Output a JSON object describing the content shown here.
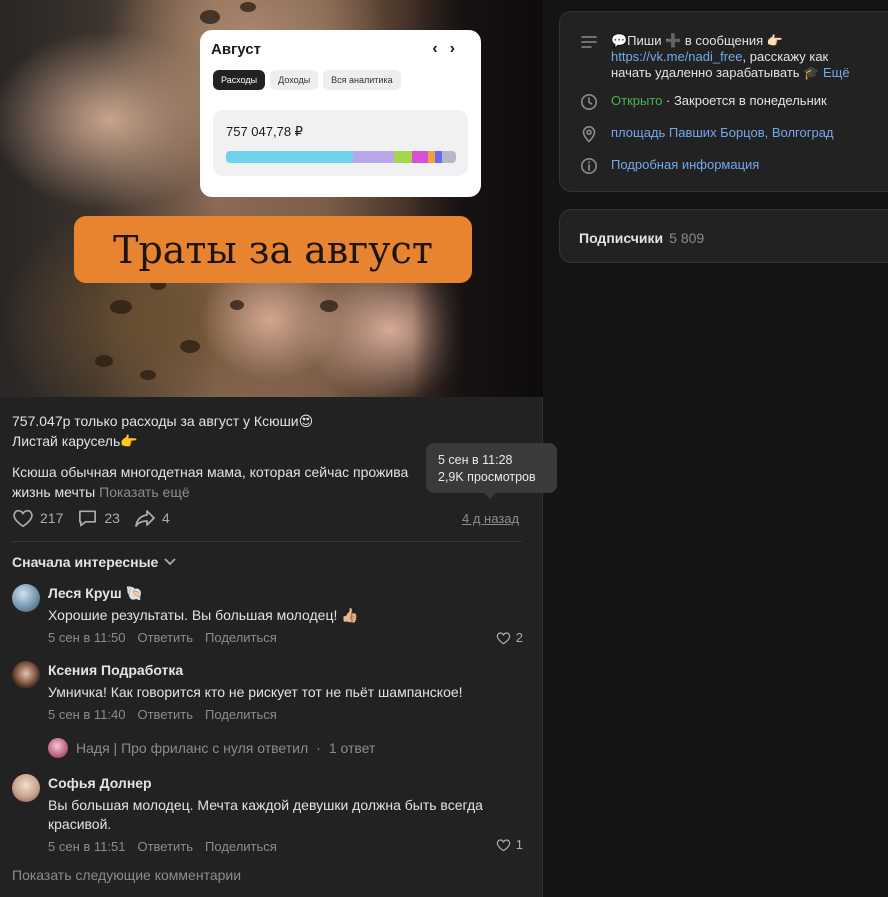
{
  "post": {
    "image": {
      "card_month": "Август",
      "card_tabs": [
        "Расходы",
        "Доходы",
        "Вся аналитика"
      ],
      "card_sum": "757 047,78 ₽",
      "spend_bar_colors": [
        "#6fd2ea",
        "#b9a6e8",
        "#a6d64f",
        "#d84fd8",
        "#f0a23a",
        "#6a6af0",
        "#b6b6c8"
      ],
      "spend_bar_shares": [
        0.55,
        0.18,
        0.08,
        0.07,
        0.03,
        0.03,
        0.06
      ],
      "banner": "Траты за август"
    },
    "text_line1": "757.047р только расходы за август у Ксюши😍",
    "text_line2": "Листай карусель👉",
    "text_line3": "Ксюша обычная многодетная мама, которая сейчас прожива",
    "text_line4": "жизнь мечты",
    "show_more": "Показать ещё",
    "tooltip_date": "5 сен в 11:28",
    "tooltip_views": "2,9K просмотров",
    "likes": "217",
    "comments": "23",
    "reposts": "4",
    "date_link": "4 д назад"
  },
  "comments_section": {
    "sort_label": "Сначала интересные",
    "items": [
      {
        "name": "Леся Круш 🐚",
        "text": "Хорошие результаты. Вы большая молодец! 👍🏼",
        "date": "5 сен в 11:50",
        "reply": "Ответить",
        "share": "Поделиться",
        "likes": "2"
      },
      {
        "name": "Ксения Подработка",
        "text": "Умничка! Как говорится кто не рискует тот не пьёт шампанское!",
        "date": "5 сен в 11:40",
        "reply": "Ответить",
        "share": "Поделиться",
        "likes": ""
      },
      {
        "name": "Софья Долнер",
        "text": "Вы большая молодец. Мечта каждой девушки должна быть всегда красивой.",
        "date": "5 сен в 11:51",
        "reply": "Ответить",
        "share": "Поделиться",
        "likes": "1"
      }
    ],
    "reply_thread": {
      "author": "Надя | Про фриланс с нуля ответил",
      "count": "1 ответ"
    },
    "show_next": "Показать следующие комментарии"
  },
  "sidebar": {
    "description_prefix": "💬Пиши ➕ в сообщения 👉🏻",
    "description_link": "https://vk.me/nadi_free",
    "description_suffix": ", расскажу как начать удаленно зарабатывать 🎓",
    "description_more": "Ещё",
    "status_open": "Открыто",
    "status_closes": "· Закроется в понедельник",
    "address": "площадь Павших Борцов, Волгоград",
    "details": "Подробная информация",
    "subscribers_label": "Подписчики",
    "subscribers_count": "5 809"
  }
}
